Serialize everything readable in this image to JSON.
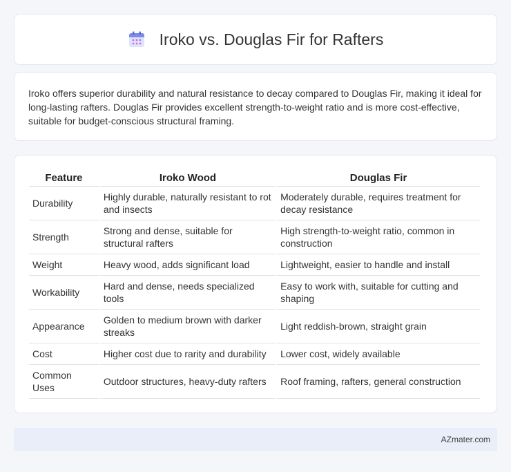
{
  "header": {
    "title": "Iroko vs. Douglas Fir for Rafters",
    "icon": "calendar-icon"
  },
  "summary": "Iroko offers superior durability and natural resistance to decay compared to Douglas Fir, making it ideal for long-lasting rafters. Douglas Fir provides excellent strength-to-weight ratio and is more cost-effective, suitable for budget-conscious structural framing.",
  "table": {
    "headers": [
      "Feature",
      "Iroko Wood",
      "Douglas Fir"
    ],
    "rows": [
      [
        "Durability",
        "Highly durable, naturally resistant to rot and insects",
        "Moderately durable, requires treatment for decay resistance"
      ],
      [
        "Strength",
        "Strong and dense, suitable for structural rafters",
        "High strength-to-weight ratio, common in construction"
      ],
      [
        "Weight",
        "Heavy wood, adds significant load",
        "Lightweight, easier to handle and install"
      ],
      [
        "Workability",
        "Hard and dense, needs specialized tools",
        "Easy to work with, suitable for cutting and shaping"
      ],
      [
        "Appearance",
        "Golden to medium brown with darker streaks",
        "Light reddish-brown, straight grain"
      ],
      [
        "Cost",
        "Higher cost due to rarity and durability",
        "Lower cost, widely available"
      ],
      [
        "Common Uses",
        "Outdoor structures, heavy-duty rafters",
        "Roof framing, rafters, general construction"
      ]
    ]
  },
  "footer": {
    "brand": "AZmater.com"
  }
}
